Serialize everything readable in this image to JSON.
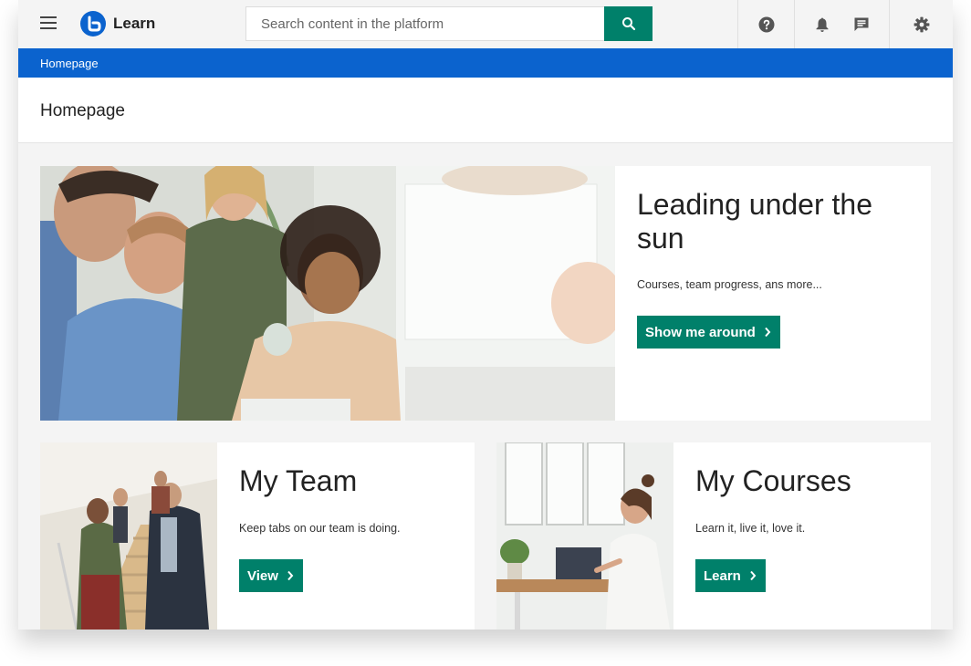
{
  "header": {
    "app_name": "Learn",
    "search_placeholder": "Search content in the platform"
  },
  "breadcrumb": {
    "label": "Homepage"
  },
  "page": {
    "title": "Homepage"
  },
  "hero": {
    "title": "Leading under the sun",
    "subtitle": "Courses, team progress, ans more...",
    "button_label": "Show me around"
  },
  "cards": [
    {
      "title": "My Team",
      "subtitle": "Keep tabs on our team is doing.",
      "button_label": "View"
    },
    {
      "title": "My Courses",
      "subtitle": "Learn it, live it, love it.",
      "button_label": "Learn"
    }
  ],
  "icons": {
    "menu": "hamburger-icon",
    "logo": "learn-logo-icon",
    "search": "search-icon",
    "help": "help-icon",
    "notifications": "bell-icon",
    "messages": "chat-icon",
    "settings": "gear-icon",
    "chevron": "chevron-right-icon"
  },
  "colors": {
    "primary_blue": "#0b63ce",
    "action_green": "#00806a",
    "background": "#f4f4f4"
  }
}
